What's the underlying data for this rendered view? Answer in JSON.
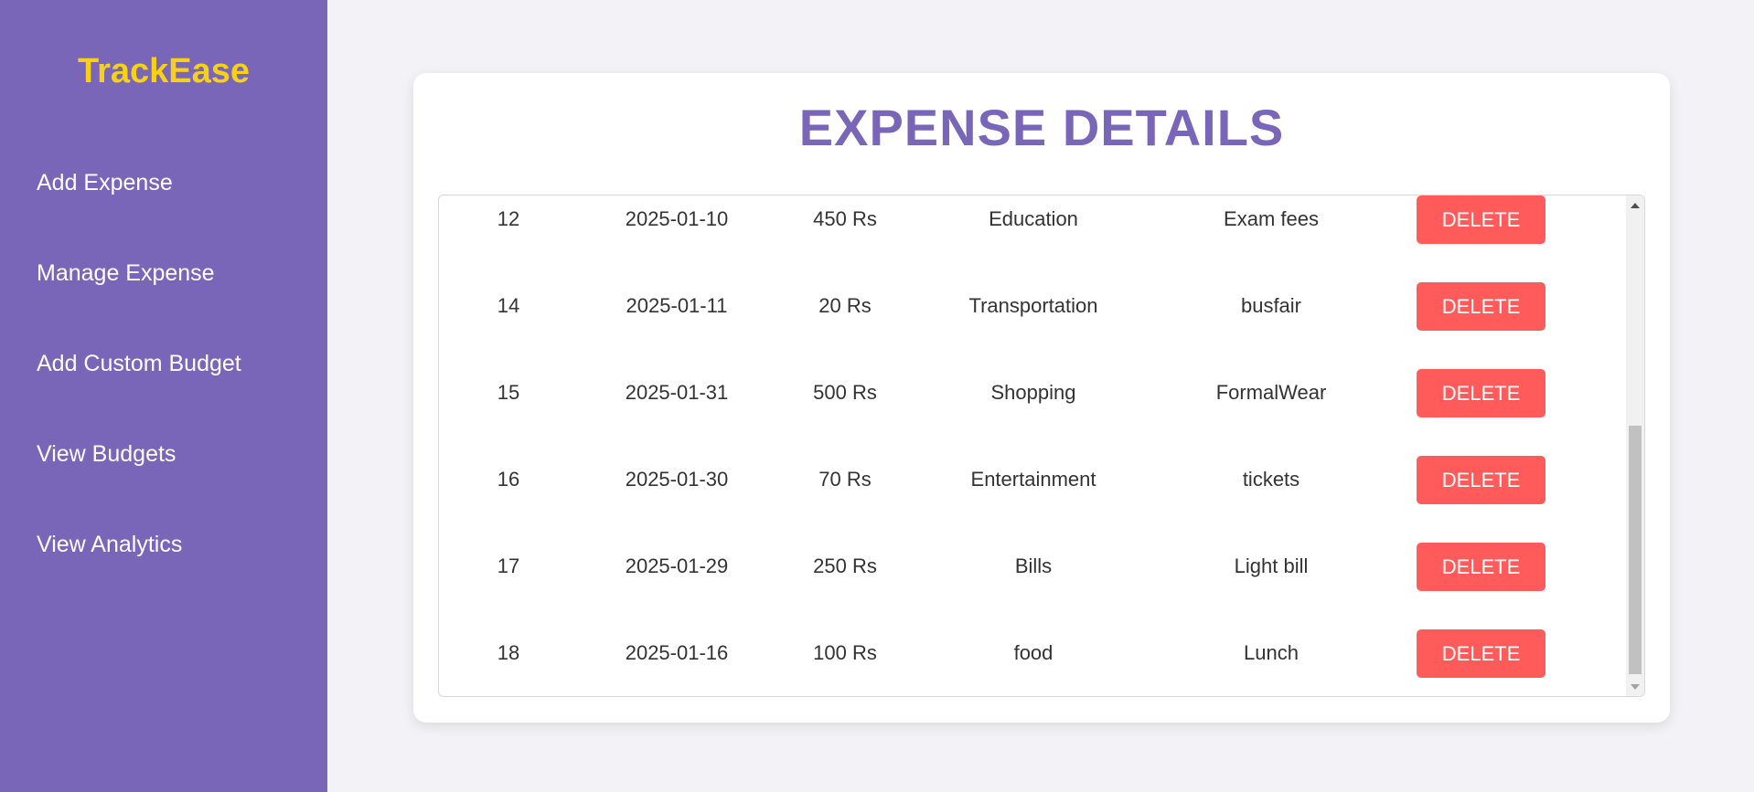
{
  "brand": "TrackEase",
  "nav": [
    "Add Expense",
    "Manage Expense",
    "Add Custom Budget",
    "View Budgets",
    "View Analytics"
  ],
  "title": "EXPENSE DETAILS",
  "rows": [
    {
      "id": "12",
      "date": "2025-01-10",
      "amount": "450 Rs",
      "category": "Education",
      "description": "Exam fees",
      "action": "DELETE"
    },
    {
      "id": "14",
      "date": "2025-01-11",
      "amount": "20 Rs",
      "category": "Transportation",
      "description": "busfair",
      "action": "DELETE"
    },
    {
      "id": "15",
      "date": "2025-01-31",
      "amount": "500 Rs",
      "category": "Shopping",
      "description": "FormalWear",
      "action": "DELETE"
    },
    {
      "id": "16",
      "date": "2025-01-30",
      "amount": "70 Rs",
      "category": "Entertainment",
      "description": "tickets",
      "action": "DELETE"
    },
    {
      "id": "17",
      "date": "2025-01-29",
      "amount": "250 Rs",
      "category": "Bills",
      "description": "Light bill",
      "action": "DELETE"
    },
    {
      "id": "18",
      "date": "2025-01-16",
      "amount": "100 Rs",
      "category": "food",
      "description": "Lunch",
      "action": "DELETE"
    }
  ],
  "colors": {
    "sidebar": "#7a66b9",
    "brand": "#f7d116",
    "title": "#7a66b9",
    "delete_button": "#ff5b5b",
    "background": "#f3f3f7"
  }
}
